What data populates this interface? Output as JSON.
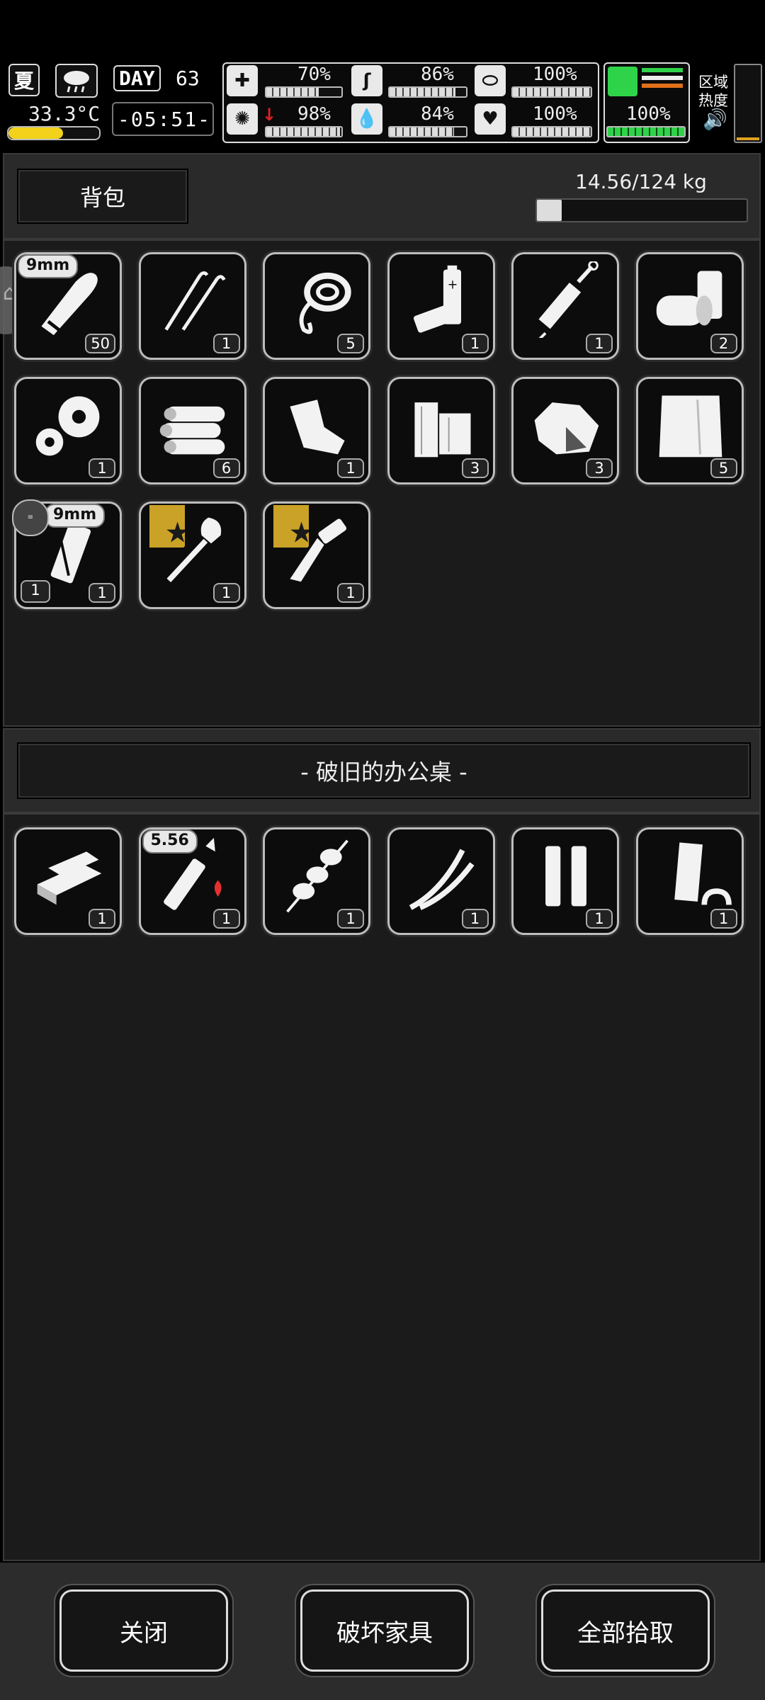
{
  "hud": {
    "season": "夏",
    "temperature": "33.3°C",
    "day_label": "DAY",
    "day_number": "63",
    "time": "-05:51-",
    "stats": [
      {
        "name": "health",
        "value": "70%",
        "level": 0.7
      },
      {
        "name": "hunger",
        "value": "86%",
        "level": 0.86
      },
      {
        "name": "energy",
        "value": "100%",
        "level": 1.0
      },
      {
        "name": "mood",
        "value": "98%",
        "level": 0.98
      },
      {
        "name": "thirst",
        "value": "84%",
        "level": 0.84
      },
      {
        "name": "heart",
        "value": "100%",
        "level": 1.0
      },
      {
        "name": "stamina",
        "value": "100%",
        "level": 1.0
      }
    ],
    "zone_label_1": "区域",
    "zone_label_2": "热度"
  },
  "backpack": {
    "title": "背包",
    "weight": "14.56/124 kg",
    "weight_fraction": 0.117,
    "items": [
      {
        "icon": "bullet-icon",
        "tag": "9mm",
        "count": "50"
      },
      {
        "icon": "lockpick-icon",
        "count": "1"
      },
      {
        "icon": "rope-icon",
        "count": "5"
      },
      {
        "icon": "battery-icon",
        "count": "1"
      },
      {
        "icon": "syringe-icon",
        "count": "1"
      },
      {
        "icon": "canned-food-icon",
        "count": "2"
      },
      {
        "icon": "gears-icon",
        "count": "1"
      },
      {
        "icon": "logs-icon",
        "count": "6"
      },
      {
        "icon": "scrap-icon",
        "count": "1"
      },
      {
        "icon": "wood-planks-icon",
        "count": "3"
      },
      {
        "icon": "stone-icon",
        "count": "3"
      },
      {
        "icon": "cloth-icon",
        "count": "5"
      },
      {
        "icon": "magazine-icon",
        "tag": "9mm",
        "count": "1",
        "count_left": "1"
      },
      {
        "icon": "shovel-icon",
        "count": "1",
        "starred": true
      },
      {
        "icon": "knife-icon",
        "count": "1",
        "starred": true
      }
    ]
  },
  "container": {
    "title": "- 破旧的办公桌 -",
    "items": [
      {
        "icon": "metal-bars-icon",
        "count": "1"
      },
      {
        "icon": "rifle-bullet-icon",
        "tag": "5.56",
        "count": "1",
        "fire": true
      },
      {
        "icon": "meat-skewer-icon",
        "count": "1"
      },
      {
        "icon": "wires-icon",
        "count": "1"
      },
      {
        "icon": "shell-casings-icon",
        "count": "1"
      },
      {
        "icon": "pipe-icon",
        "count": "1"
      }
    ]
  },
  "buttons": {
    "close": "关闭",
    "destroy": "破坏家具",
    "take_all": "全部拾取"
  }
}
